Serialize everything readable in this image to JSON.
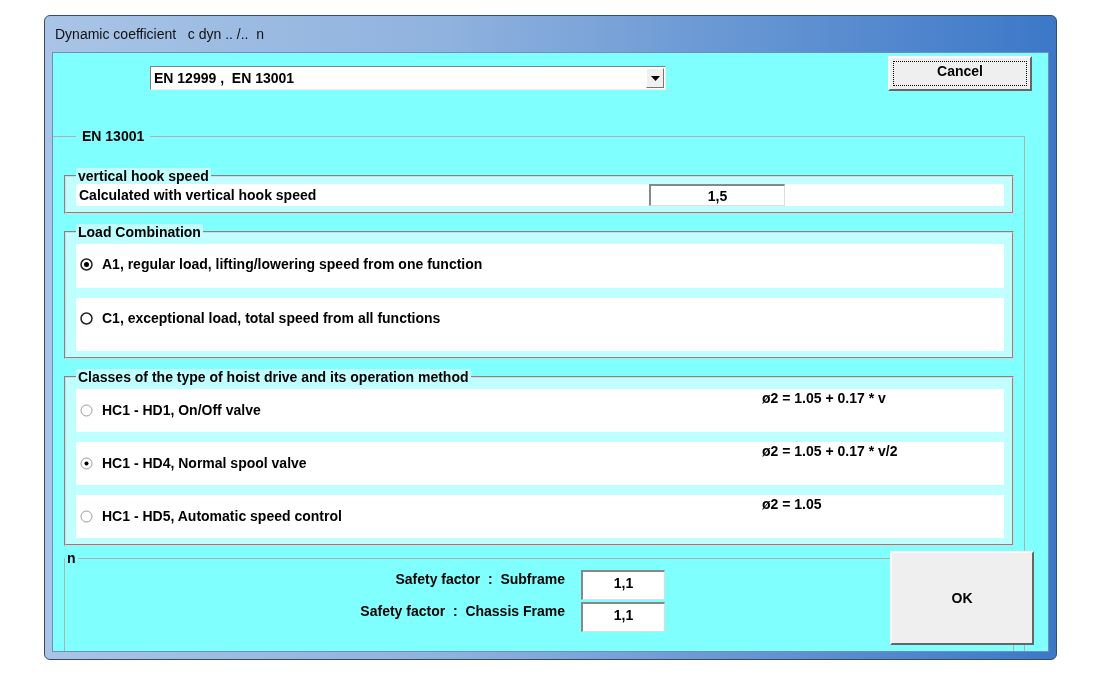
{
  "window": {
    "title": "Dynamic coefficient   c dyn .. /..  n"
  },
  "standard_dropdown": {
    "value": "EN 12999 ,  EN 13001"
  },
  "cancel_button": {
    "label": "Cancel",
    "focused": true
  },
  "group": {
    "title": "EN 13001",
    "hook_speed": {
      "title": "vertical hook speed",
      "label": "Calculated with vertical hook speed",
      "value": "1,5"
    },
    "load_combination": {
      "title": "Load Combination",
      "options": [
        {
          "label": "A1, regular load, lifting/lowering speed from one function",
          "selected": true
        },
        {
          "label": "C1, exceptional load, total speed from all functions",
          "selected": false
        }
      ]
    },
    "hoist_classes": {
      "title": "Classes of the type of hoist drive and its operation method",
      "options": [
        {
          "label": "HC1 - HD1, On/Off valve",
          "formula": "ø2 = 1.05 + 0.17 * v",
          "selected": false
        },
        {
          "label": "HC1 - HD4, Normal spool valve",
          "formula": "ø2 = 1.05 + 0.17 * v/2",
          "selected": true
        },
        {
          "label": "HC1 - HD5, Automatic speed control",
          "formula": "ø2 = 1.05",
          "selected": false
        }
      ]
    },
    "n": {
      "title": "n",
      "fields": [
        {
          "label": "Safety factor  :  Subframe",
          "value": "1,1"
        },
        {
          "label": "Safety factor  :  Chassis Frame",
          "value": "1,1"
        }
      ]
    }
  },
  "ok_button": {
    "label": "OK"
  }
}
